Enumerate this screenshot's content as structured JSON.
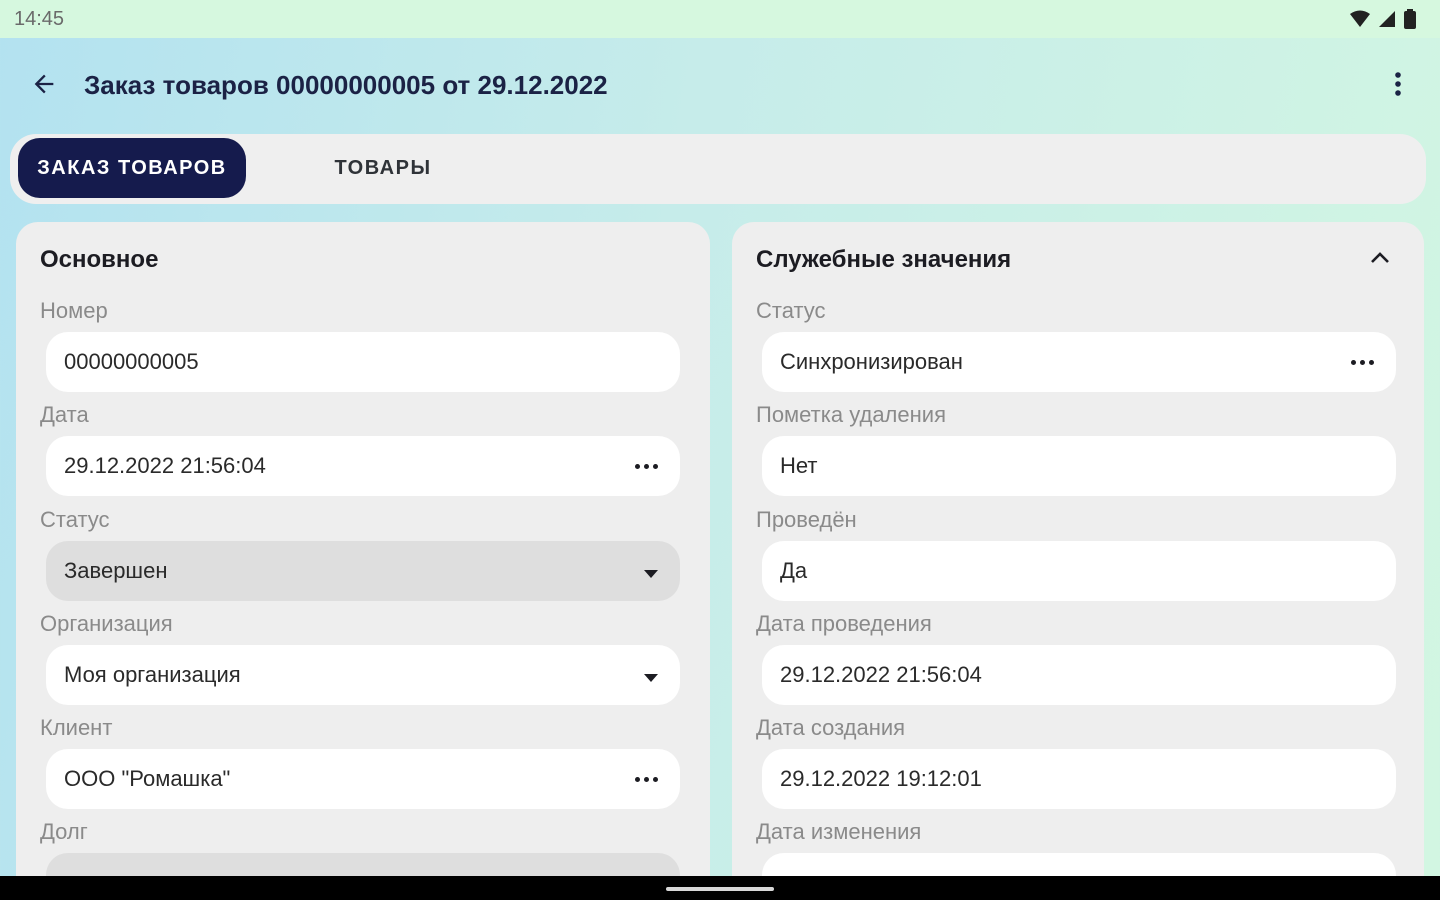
{
  "status_bar": {
    "time": "14:45"
  },
  "app_bar": {
    "title": "Заказ товаров 00000000005 от 29.12.2022"
  },
  "tabs": [
    {
      "label": "ЗАКАЗ ТОВАРОВ",
      "active": true
    },
    {
      "label": "ТОВАРЫ",
      "active": false
    }
  ],
  "left_card": {
    "title": "Основное",
    "fields": [
      {
        "label": "Номер",
        "value": "00000000005",
        "control": "text"
      },
      {
        "label": "Дата",
        "value": "29.12.2022 21:56:04",
        "control": "picker"
      },
      {
        "label": "Статус",
        "value": "Завершен",
        "control": "dropdown-disabled"
      },
      {
        "label": "Организация",
        "value": "Моя организация",
        "control": "dropdown"
      },
      {
        "label": "Клиент",
        "value": "ООО \"Ромашка\"",
        "control": "picker"
      },
      {
        "label": "Долг",
        "value": "",
        "control": "disabled"
      }
    ]
  },
  "right_card": {
    "title": "Служебные значения",
    "fields": [
      {
        "label": "Статус",
        "value": "Синхронизирован",
        "control": "picker"
      },
      {
        "label": "Пометка удаления",
        "value": "Нет",
        "control": "text"
      },
      {
        "label": "Проведён",
        "value": "Да",
        "control": "text"
      },
      {
        "label": "Дата проведения",
        "value": "29.12.2022 21:56:04",
        "control": "text"
      },
      {
        "label": "Дата создания",
        "value": "29.12.2022 19:12:01",
        "control": "text"
      },
      {
        "label": "Дата изменения",
        "value": "",
        "control": "text"
      }
    ]
  },
  "colors": {
    "primary": "#151b4d",
    "title": "#1b2245",
    "card_bg": "#eeeeee",
    "field_bg": "#ffffff",
    "field_disabled_bg": "#dedede"
  }
}
